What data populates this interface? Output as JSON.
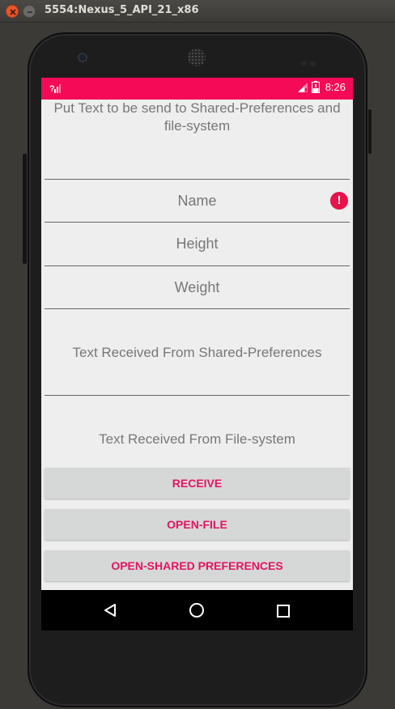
{
  "window": {
    "title": "5554:Nexus_5_API_21_x86"
  },
  "status_bar": {
    "time": "8:26",
    "color": "#f50a57"
  },
  "header": {
    "text": "Put Text to be send to Shared-Preferences and file-system"
  },
  "fields": {
    "blank": {
      "value": ""
    },
    "name": {
      "value": "Name"
    },
    "height": {
      "value": "Height"
    },
    "weight": {
      "value": "Weight"
    },
    "shared_received": {
      "value": "Text Received From Shared-Preferences"
    },
    "file_received": {
      "value": "Text Received From File-system"
    }
  },
  "buttons": {
    "receive": "RECEIVE",
    "open_file": "OPEN-FILE",
    "open_shared": "OPEN-SHARED PREFERENCES"
  },
  "colors": {
    "accent": "#e01562",
    "error": "#e8114a",
    "focus_underline": "#2a9d8f"
  },
  "icons": [
    "close-icon",
    "minimize-icon",
    "signal-icon",
    "battery-icon",
    "error-icon",
    "back-icon",
    "home-icon",
    "recent-apps-icon"
  ]
}
